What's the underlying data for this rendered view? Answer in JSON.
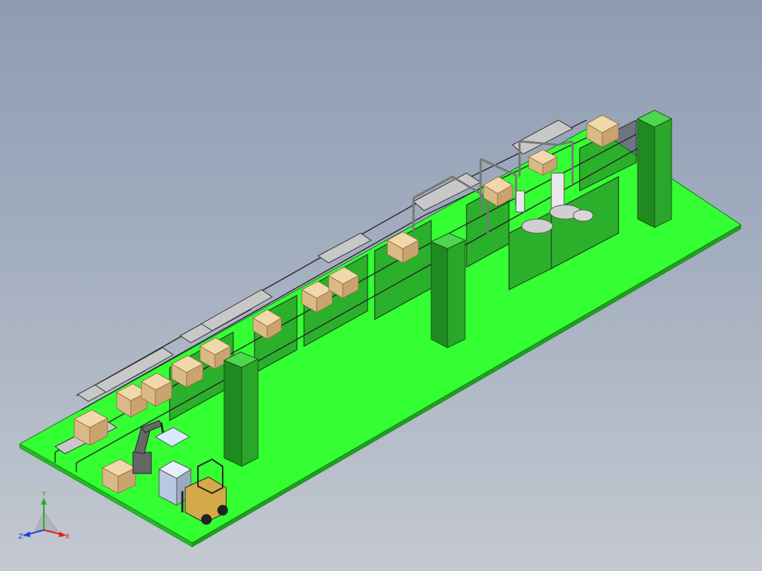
{
  "viewport": {
    "background_top": "#8e9cb3",
    "background_bottom": "#c4c9d1"
  },
  "colors": {
    "floor": "#33ff33",
    "floor_edge": "#1a7a1a",
    "pillar_light": "#36c236",
    "pillar_dark": "#1f8a1f",
    "box": "#e6c99a",
    "box_dark": "#b89868",
    "frame": "#2a2a2a",
    "forklift": "#d4a94a"
  },
  "triad": {
    "x_label": "X",
    "y_label": "Y",
    "z_label": "Z",
    "x_color": "#e02020",
    "y_color": "#20b020",
    "z_color": "#2040e0"
  }
}
